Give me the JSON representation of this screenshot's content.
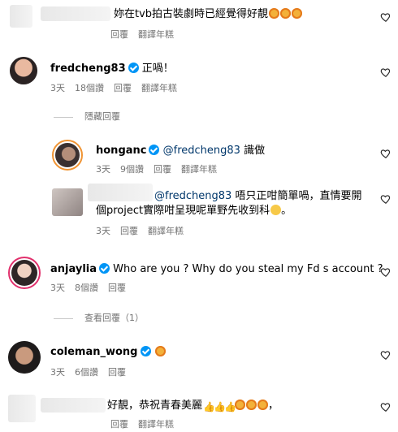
{
  "comments": [
    {
      "text": "妳在tvb拍古裝劇時已經覺得好靚",
      "meta": [
        "回覆",
        "翻譯年糕"
      ]
    },
    {
      "username": "fredcheng83",
      "text": "正喎！",
      "meta": [
        "3天",
        "18個讚",
        "回覆",
        "翻譯年糕"
      ]
    },
    {
      "hide_replies": "隱藏回覆"
    },
    {
      "username": "honganc",
      "mention": "@fredcheng83",
      "text": "識做",
      "meta": [
        "3天",
        "9個讚",
        "回覆",
        "翻譯年糕"
      ]
    },
    {
      "mention": "@fredcheng83",
      "text_line1": "唔只正咁簡單喎，直情要開",
      "text_line2": "個project實際咁呈現呢單野先收到科",
      "meta": [
        "3天",
        "回覆",
        "翻譯年糕"
      ]
    },
    {
      "username": "anjaylia",
      "text": "Who are you ? Why do you steal my Fd s account ?",
      "meta": [
        "3天",
        "8個讚",
        "回覆"
      ]
    },
    {
      "view_replies": "查看回覆（1）"
    },
    {
      "username": "coleman_wong",
      "meta": [
        "3天",
        "6個讚",
        "回覆"
      ]
    },
    {
      "text": "好靚，恭祝青春美麗",
      "meta": [
        "回覆",
        "翻譯年糕"
      ]
    }
  ],
  "icons": {
    "like": "heart-outline-icon",
    "verified": "verified-badge-icon"
  },
  "colors": {
    "verified": "#0095f6",
    "mention": "#00376b",
    "meta": "#737373"
  }
}
